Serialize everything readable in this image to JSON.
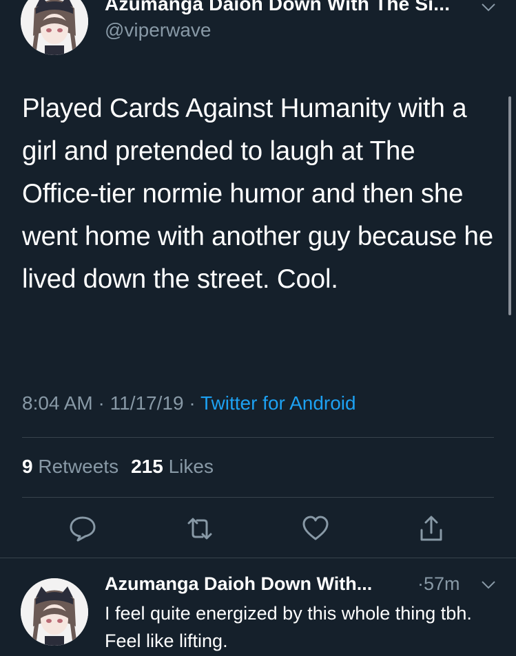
{
  "tweet": {
    "author_name": "Azumanga Daioh Down With The Si...",
    "author_handle": "@viperwave",
    "text": "Played Cards Against Humanity with a girl and pretended to laugh at The Office-tier normie humor and then she went home with another guy because he lived down the street. Cool.",
    "time": "8:04 AM",
    "date": "11/17/19",
    "separator": " · ",
    "source": "Twitter for Android",
    "retweets_count": "9",
    "retweets_label": "Retweets",
    "likes_count": "215",
    "likes_label": "Likes"
  },
  "actions": {
    "reply_icon": "reply-icon",
    "retweet_icon": "retweet-icon",
    "like_icon": "heart-icon",
    "share_icon": "share-icon"
  },
  "reply": {
    "author_name": "Azumanga Daioh Down With...",
    "time": "·57m",
    "text": "I feel quite energized by this whole thing tbh. Feel like lifting."
  },
  "colors": {
    "background": "#15202b",
    "secondary_text": "#8899a6",
    "link": "#1da1f2",
    "divider": "#38444d"
  }
}
